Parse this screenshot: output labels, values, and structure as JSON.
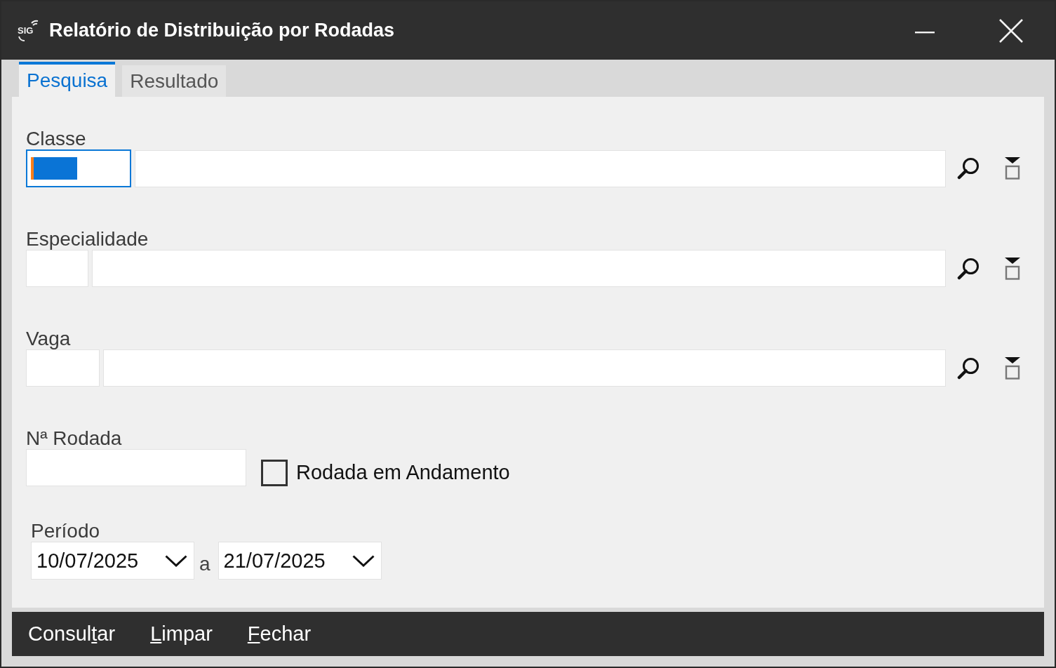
{
  "window": {
    "logo": "SIG",
    "title": "Relatório de Distribuição por Rodadas"
  },
  "tabs": [
    {
      "label": "Pesquisa",
      "selected": true
    },
    {
      "label": "Resultado",
      "selected": false
    }
  ],
  "form": {
    "lookups": [
      {
        "label": "Classe",
        "focused": true
      },
      {
        "label": "Especialidade",
        "focused": false
      },
      {
        "label": "Vaga",
        "focused": false
      }
    ],
    "round_number": {
      "label": "Nª Rodada"
    },
    "in_progress": {
      "label": "Rodada em Andamento",
      "checked": false
    },
    "period": {
      "label": "Período",
      "from": "10/07/2025",
      "separator": "a",
      "to": "21/07/2025"
    }
  },
  "buttons": [
    {
      "before": "Consul",
      "access_key": "t",
      "after": "ar"
    },
    {
      "access_key": "L",
      "after": "impar"
    },
    {
      "access_key": "F",
      "after": "echar"
    }
  ]
}
